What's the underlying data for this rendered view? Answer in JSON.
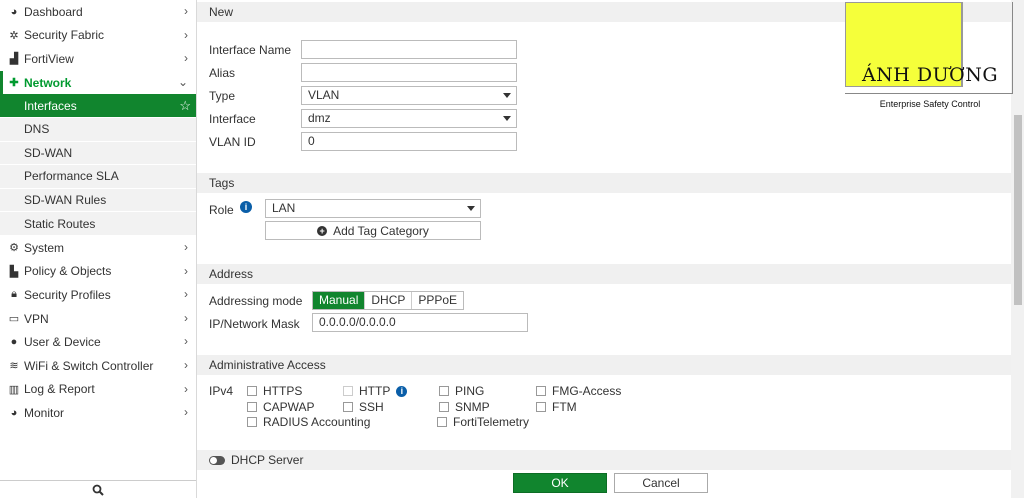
{
  "sidebar": {
    "items": [
      {
        "label": "Dashboard",
        "icon": "dashboard-icon"
      },
      {
        "label": "Security Fabric",
        "icon": "security-fabric-icon"
      },
      {
        "label": "FortiView",
        "icon": "fortiview-icon"
      },
      {
        "label": "Network",
        "icon": "network-icon"
      },
      {
        "label": "System",
        "icon": "gear-icon"
      },
      {
        "label": "Policy & Objects",
        "icon": "policy-icon"
      },
      {
        "label": "Security Profiles",
        "icon": "lock-icon"
      },
      {
        "label": "VPN",
        "icon": "vpn-icon"
      },
      {
        "label": "User & Device",
        "icon": "user-icon"
      },
      {
        "label": "WiFi & Switch Controller",
        "icon": "wifi-icon"
      },
      {
        "label": "Log & Report",
        "icon": "chart-icon"
      },
      {
        "label": "Monitor",
        "icon": "monitor-icon"
      }
    ],
    "network_sub": [
      "Interfaces",
      "DNS",
      "SD-WAN",
      "Performance SLA",
      "SD-WAN Rules",
      "Static Routes"
    ]
  },
  "form": {
    "section_new": "New",
    "interface_name_label": "Interface Name",
    "interface_name_value": "",
    "alias_label": "Alias",
    "alias_value": "",
    "type_label": "Type",
    "type_value": "VLAN",
    "interface_label": "Interface",
    "interface_value": "dmz",
    "vlan_id_label": "VLAN ID",
    "vlan_id_value": "0",
    "section_tags": "Tags",
    "role_label": "Role",
    "role_value": "LAN",
    "add_tag_label": "Add Tag Category",
    "section_address": "Address",
    "addressing_mode_label": "Addressing mode",
    "addressing_modes": [
      "Manual",
      "DHCP",
      "PPPoE"
    ],
    "ip_mask_label": "IP/Network Mask",
    "ip_mask_value": "0.0.0.0/0.0.0.0",
    "section_admin": "Administrative Access",
    "ipv4_label": "IPv4",
    "access": [
      "HTTPS",
      "HTTP",
      "PING",
      "FMG-Access",
      "CAPWAP",
      "SSH",
      "SNMP",
      "FTM",
      "RADIUS Accounting",
      "FortiTelemetry"
    ],
    "dhcp_server_label": "DHCP Server"
  },
  "footer": {
    "ok_label": "OK",
    "cancel_label": "Cancel"
  },
  "logo": {
    "brand": "ÁNH DƯƠNG",
    "tagline": "Enterprise Safety Control"
  },
  "colors": {
    "accent": "#11852e",
    "logo_yellow": "#f5ff3a"
  }
}
